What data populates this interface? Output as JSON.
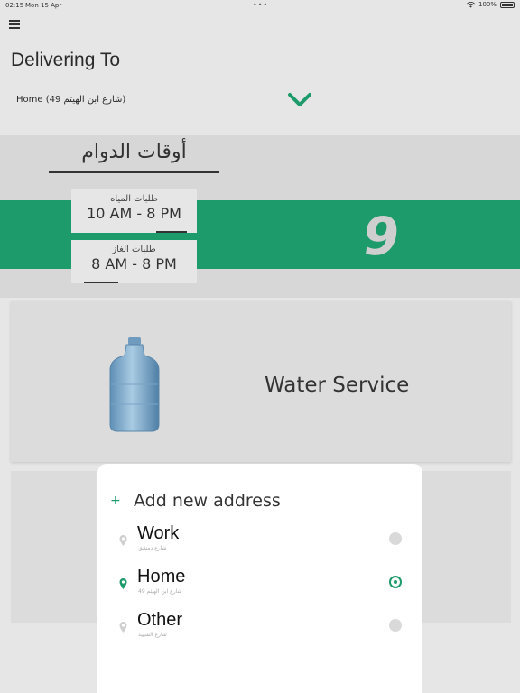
{
  "status_bar": {
    "time": "02:15",
    "date": "Mon 15 Apr",
    "battery": "100%"
  },
  "header": {
    "title": "Delivering To",
    "selected_address": "Home (49 شارع ابن الهيثم)"
  },
  "hero": {
    "hours_title": "أوقات الدوام",
    "water_hours": {
      "label": "طلبات المياه",
      "value": "10 AM - 8 PM"
    },
    "gas_hours": {
      "label": "طلبات الغاز",
      "value": "8 AM - 8 PM"
    },
    "logo_text": "9"
  },
  "services": [
    {
      "title": "Water Service"
    }
  ],
  "sheet": {
    "add_label": "Add new address",
    "options": [
      {
        "name": "Work",
        "street": "شارع دمشق",
        "selected": false
      },
      {
        "name": "Home",
        "street": "49 شارع ابن الهيثم",
        "selected": true
      },
      {
        "name": "Other",
        "street": "شارع الشهيد",
        "selected": false
      }
    ]
  },
  "colors": {
    "accent": "#1e9b6b",
    "band": "#1e9b6b",
    "background": "#e6e6e6"
  }
}
